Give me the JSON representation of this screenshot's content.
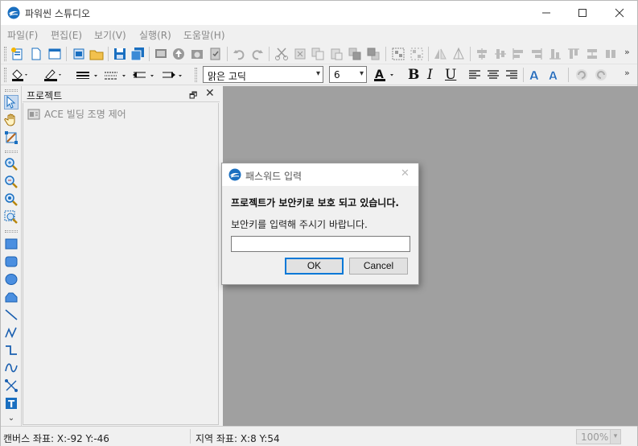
{
  "window": {
    "title": "파워씬 스튜디오"
  },
  "menu": {
    "items": [
      "파일(F)",
      "편집(E)",
      "보기(V)",
      "실행(R)",
      "도움말(H)"
    ]
  },
  "toolbar": {
    "font_name": "맑은 고딕",
    "font_size": "6",
    "bold_label": "B",
    "italic_label": "I",
    "underline_label": "U"
  },
  "project_panel": {
    "title": "프로젝트",
    "tree_item": "ACE 빌딩 조명 제어"
  },
  "status": {
    "canvas_coords": "캔버스 좌표: X:-92 Y:-46",
    "region_coords": "지역 좌표: X:8 Y:54",
    "zoom": "100%"
  },
  "dialog": {
    "title": "패스워드 입력",
    "message": "프로젝트가 보안키로 보호 되고 있습니다.",
    "prompt": "보안키를 입력해 주시기 바랍니다.",
    "input_value": "",
    "ok_label": "OK",
    "cancel_label": "Cancel"
  },
  "colors": {
    "canvas_bg": "#a0a0a0",
    "accent_blue": "#0078d7",
    "app_icon_blue": "#1a6fc0"
  }
}
